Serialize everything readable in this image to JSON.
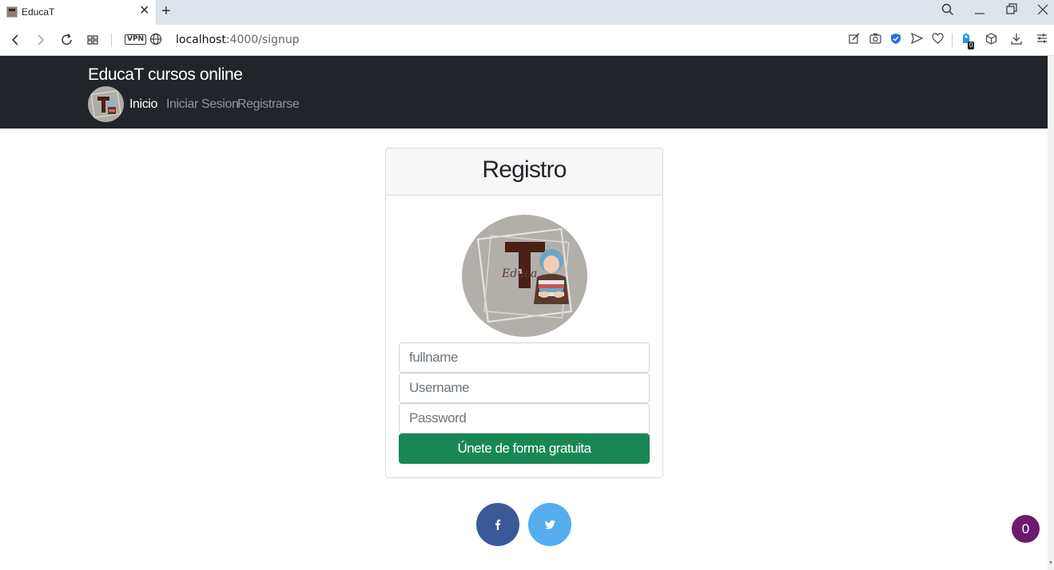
{
  "browser": {
    "tab_title": "EducaT",
    "tab_close": "✕",
    "new_tab": "+",
    "vpn": "VPN",
    "url_host": "localhost",
    "url_path": ":4000/signup",
    "extension_badge": "0"
  },
  "navbar": {
    "brand": "EducaT cursos online",
    "links": [
      {
        "label": "Inicio"
      },
      {
        "label": "Iniciar Sesion"
      },
      {
        "label": "Registrarse"
      }
    ]
  },
  "form": {
    "title": "Registro",
    "fullname_placeholder": "fullname",
    "username_placeholder": "Username",
    "password_placeholder": "Password",
    "submit_label": "Únete de forma gratuita"
  },
  "logo": {
    "text": "Educa"
  },
  "social": {
    "facebook_color": "#3b5998",
    "twitter_color": "#55acee"
  },
  "chat": {
    "count": "0"
  },
  "colors": {
    "navbar_bg": "#212529",
    "submit_bg": "#198754",
    "chat_bg": "#6c1a6e"
  }
}
